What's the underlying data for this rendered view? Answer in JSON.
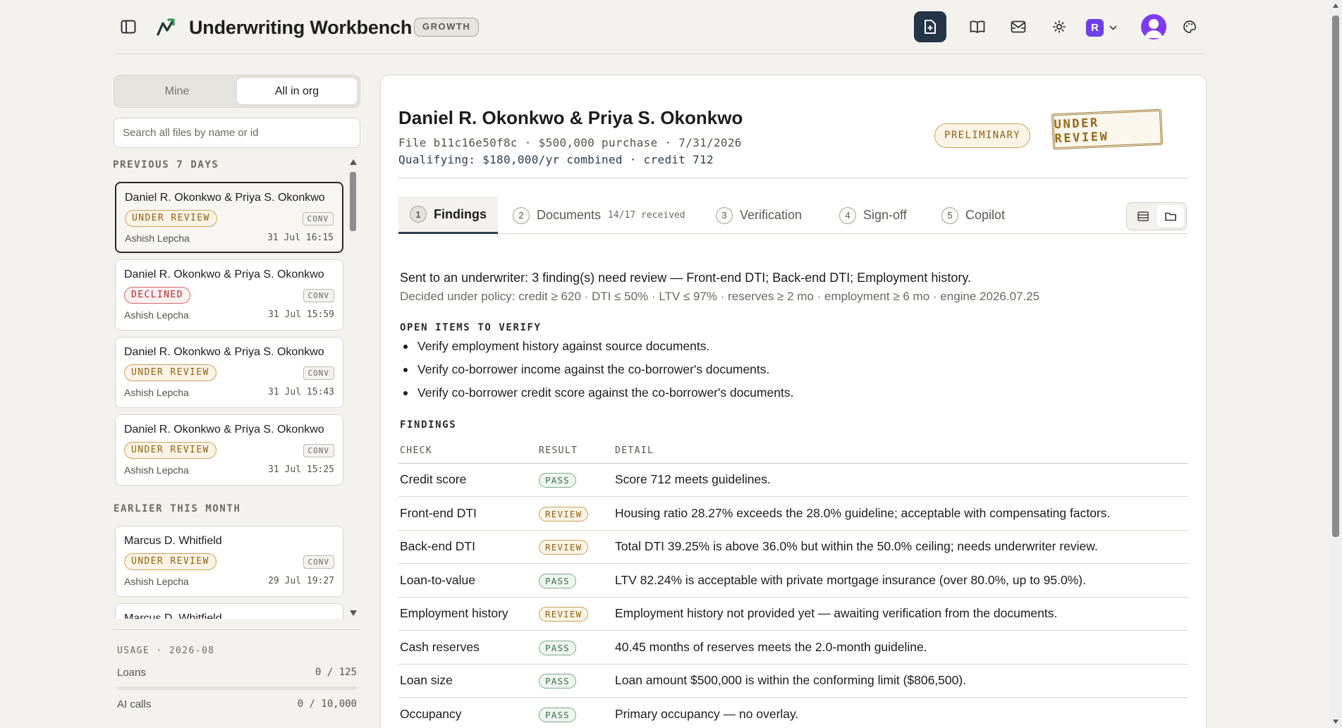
{
  "app": {
    "title": "Underwriting Workbench",
    "plan_badge": "GROWTH",
    "org_initial": "R",
    "icons": [
      "sidebar-toggle-icon",
      "app-logo-icon",
      "new-file-icon",
      "book-icon",
      "inbox-icon",
      "settings-icon",
      "org-switcher",
      "avatar",
      "palette-icon"
    ]
  },
  "sidebar": {
    "filter": {
      "mine": "Mine",
      "all": "All in org",
      "active": "All in org"
    },
    "search_placeholder": "Search all files by name or id",
    "groups": [
      {
        "heading": "PREVIOUS 7 DAYS",
        "files": [
          {
            "name": "Daniel R. Okonkwo & Priya S. Okonkwo",
            "status": "UNDER REVIEW",
            "type": "CONV",
            "owner": "Ashish Lepcha",
            "time": "31 Jul 16:15",
            "selected": true
          },
          {
            "name": "Daniel R. Okonkwo & Priya S. Okonkwo",
            "status": "DECLINED",
            "type": "CONV",
            "owner": "Ashish Lepcha",
            "time": "31 Jul 15:59"
          },
          {
            "name": "Daniel R. Okonkwo & Priya S. Okonkwo",
            "status": "UNDER REVIEW",
            "type": "CONV",
            "owner": "Ashish Lepcha",
            "time": "31 Jul 15:43"
          },
          {
            "name": "Daniel R. Okonkwo & Priya S. Okonkwo",
            "status": "UNDER REVIEW",
            "type": "CONV",
            "owner": "Ashish Lepcha",
            "time": "31 Jul 15:25"
          }
        ]
      },
      {
        "heading": "EARLIER THIS MONTH",
        "files": [
          {
            "name": "Marcus D. Whitfield",
            "status": "UNDER REVIEW",
            "type": "CONV",
            "owner": "Ashish Lepcha",
            "time": "29 Jul 19:27"
          },
          {
            "name": "Marcus D. Whitfield",
            "status": "",
            "type": "",
            "owner": "",
            "time": ""
          }
        ]
      }
    ],
    "usage": {
      "heading": "USAGE · 2026-08",
      "loans_label": "Loans",
      "loans_value": "0 / 125",
      "loans_fraction": 0,
      "ai_label": "AI calls",
      "ai_value": "0 / 10,000",
      "ai_fraction": 0
    }
  },
  "file": {
    "borrowers": "Daniel R. Okonkwo & Priya S. Okonkwo",
    "meta_line": "File b11c16e50f8c · $500,000 purchase · 7/31/2026",
    "qualifying_line": "Qualifying: $180,000/yr combined · credit 712",
    "preliminary_badge": "PRELIMINARY",
    "status_stamp": "UNDER REVIEW"
  },
  "tabs": [
    {
      "num": "1",
      "label": "Findings",
      "sub": "",
      "active": true
    },
    {
      "num": "2",
      "label": "Documents",
      "sub": "14/17 received"
    },
    {
      "num": "3",
      "label": "Verification",
      "sub": ""
    },
    {
      "num": "4",
      "label": "Sign-off",
      "sub": ""
    },
    {
      "num": "5",
      "label": "Copilot",
      "sub": ""
    }
  ],
  "view_switch": {
    "options": [
      "list-view-icon",
      "folder-view-icon"
    ],
    "active": "folder-view-icon"
  },
  "findings": {
    "summary": "Sent to an underwriter: 3 finding(s) need review — Front-end DTI; Back-end DTI; Employment history.",
    "policy": "Decided under policy: credit ≥ 620 · DTI ≤ 50% · LTV ≤ 97% · reserves ≥ 2 mo · employment ≥ 6 mo · engine 2026.07.25",
    "open_items_heading": "OPEN ITEMS TO VERIFY",
    "open_items": [
      "Verify employment history against source documents.",
      "Verify co-borrower income against the co-borrower's documents.",
      "Verify co-borrower credit score against the co-borrower's documents."
    ],
    "findings_heading": "FINDINGS",
    "columns": [
      "CHECK",
      "RESULT",
      "DETAIL"
    ],
    "rows": [
      {
        "check": "Credit score",
        "result": "PASS",
        "detail": "Score 712 meets guidelines."
      },
      {
        "check": "Front-end DTI",
        "result": "REVIEW",
        "detail": "Housing ratio 28.27% exceeds the 28.0% guideline; acceptable with compensating factors."
      },
      {
        "check": "Back-end DTI",
        "result": "REVIEW",
        "detail": "Total DTI 39.25% is above 36.0% but within the 50.0% ceiling; needs underwriter review."
      },
      {
        "check": "Loan-to-value",
        "result": "PASS",
        "detail": "LTV 82.24% is acceptable with private mortgage insurance (over 80.0%, up to 95.0%)."
      },
      {
        "check": "Employment history",
        "result": "REVIEW",
        "detail": "Employment history not provided yet — awaiting verification from the documents."
      },
      {
        "check": "Cash reserves",
        "result": "PASS",
        "detail": "40.45 months of reserves meets the 2.0-month guideline."
      },
      {
        "check": "Loan size",
        "result": "PASS",
        "detail": "Loan amount $500,000 is within the conforming limit ($806,500)."
      },
      {
        "check": "Occupancy",
        "result": "PASS",
        "detail": "Primary occupancy — no overlay."
      }
    ]
  }
}
